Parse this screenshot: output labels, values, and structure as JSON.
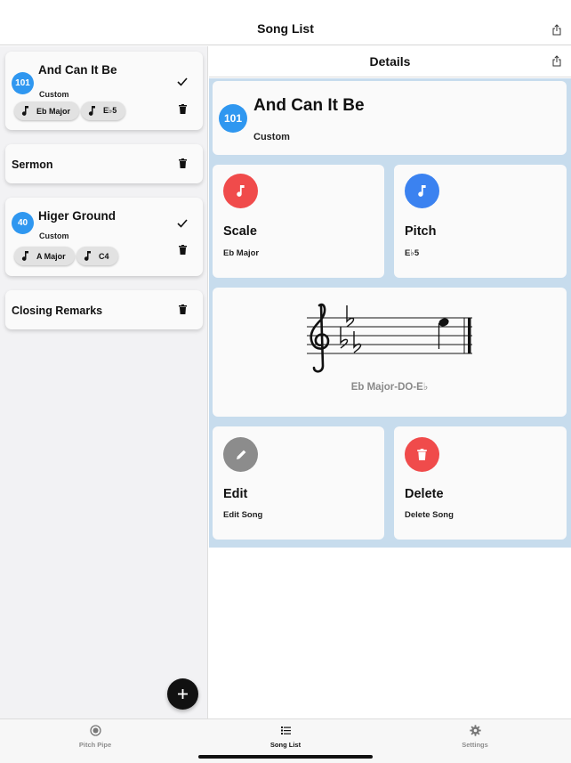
{
  "nav": {
    "title": "Song List"
  },
  "songs": [
    {
      "number": "101",
      "title": "And Can It Be",
      "subtitle": "Custom",
      "scale": "Eb Major",
      "pitch": "E♭5"
    },
    {
      "title": "Sermon"
    },
    {
      "number": "40",
      "title": "Higer Ground",
      "subtitle": "Custom",
      "scale": "A Major",
      "pitch": "C4"
    },
    {
      "title": "Closing Remarks"
    }
  ],
  "details": {
    "header": "Details",
    "number": "101",
    "title": "And Can It Be",
    "subtitle": "Custom",
    "scale": {
      "label": "Scale",
      "value": "Eb Major",
      "color": "#f04b4b"
    },
    "pitch": {
      "label": "Pitch",
      "value": "E♭5",
      "color": "#3b82f0"
    },
    "staff_caption": "Eb Major-DO-E♭",
    "edit": {
      "label": "Edit",
      "sub": "Edit Song",
      "color": "#8c8c8c"
    },
    "delete": {
      "label": "Delete",
      "sub": "Delete Song",
      "color": "#f04b4b"
    }
  },
  "tabs": [
    {
      "label": "Pitch Pipe",
      "icon": "record-icon"
    },
    {
      "label": "Song List",
      "icon": "list-icon"
    },
    {
      "label": "Settings",
      "icon": "gear-icon"
    }
  ],
  "icons": [
    "share-icon",
    "checkmark-icon",
    "trash-icon",
    "music-note-icon",
    "pencil-icon",
    "plus-icon",
    "treble-clef-icon",
    "flat-icon"
  ]
}
